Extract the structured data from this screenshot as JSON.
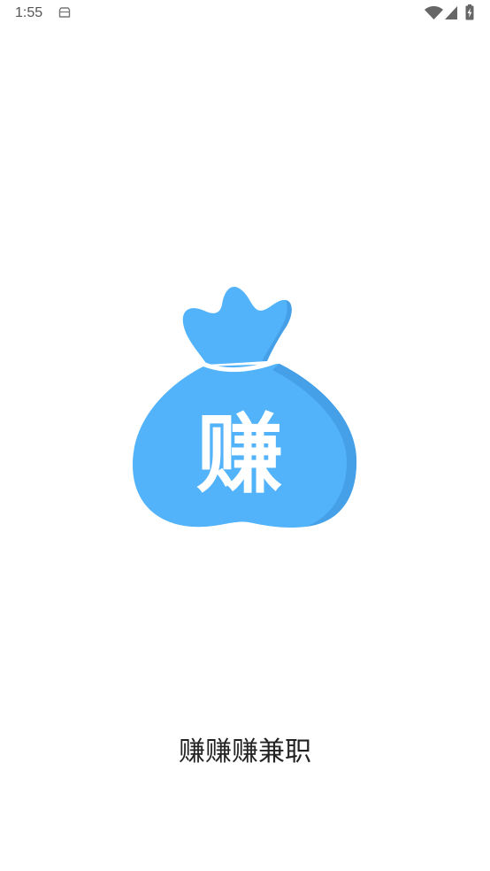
{
  "status_bar": {
    "time": "1:55",
    "icons": {
      "notification": "clipboard-icon",
      "wifi": "wifi-icon",
      "signal": "signal-icon",
      "battery": "battery-charging-icon"
    }
  },
  "splash": {
    "logo": {
      "icon": "money-bag-icon",
      "glyph": "赚",
      "color": "#52b3fa",
      "shade_color": "#45a0e8"
    },
    "app_name": "赚赚赚兼职"
  },
  "colors": {
    "background": "#ffffff",
    "text": "#222222",
    "status_text": "#555555"
  }
}
